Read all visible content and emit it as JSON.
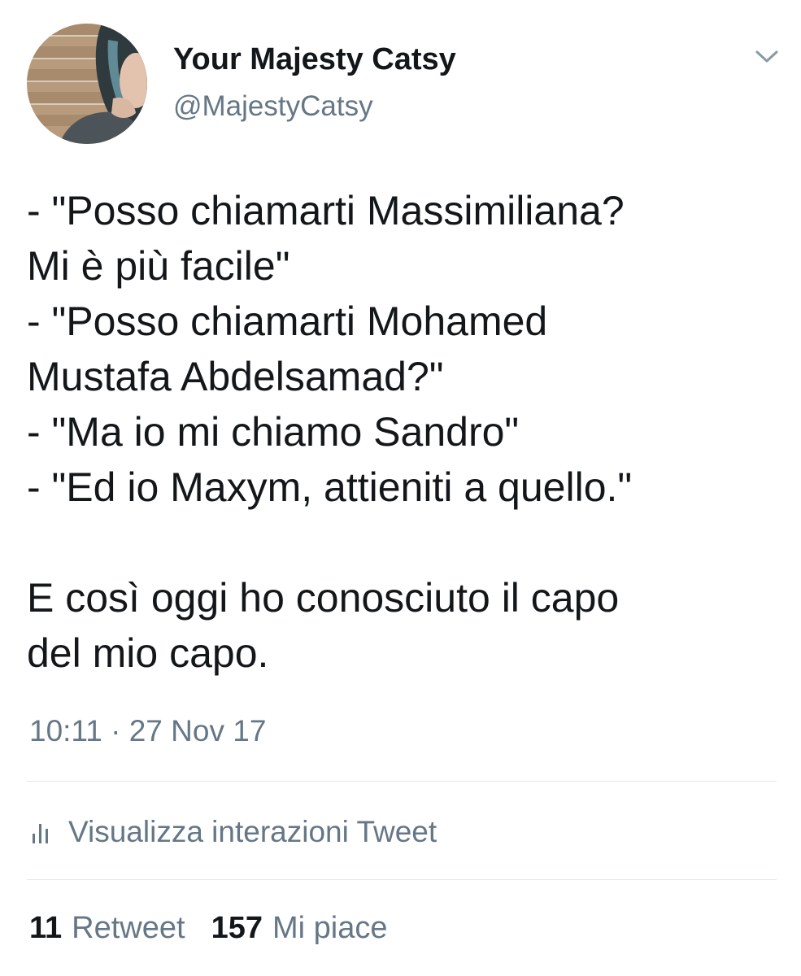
{
  "user": {
    "display_name": "Your Majesty Catsy",
    "handle": "@MajestyCatsy",
    "avatar_icon": "profile-photo"
  },
  "tweet": {
    "lines": [
      "- \"Posso chiamarti Massimiliana?",
      "Mi è più facile\"",
      "- \"Posso chiamarti Mohamed",
      "Mustafa Abdelsamad?\"",
      "- \"Ma io mi chiamo Sandro\"",
      "- \"Ed io Maxym, attieniti a quello.\"",
      "",
      "E così oggi ho conosciuto il capo",
      "del mio capo."
    ],
    "timestamp": "10:11 · 27 Nov 17"
  },
  "activity": {
    "label": "Visualizza interazioni Tweet",
    "icon": "bar-chart-icon"
  },
  "stats": {
    "retweet_count": "11",
    "retweet_label": "Retweet",
    "likes_count": "157",
    "likes_label": "Mi piace"
  },
  "colors": {
    "text_primary": "#14171a",
    "text_secondary": "#657786",
    "divider": "#e1e8ed"
  }
}
